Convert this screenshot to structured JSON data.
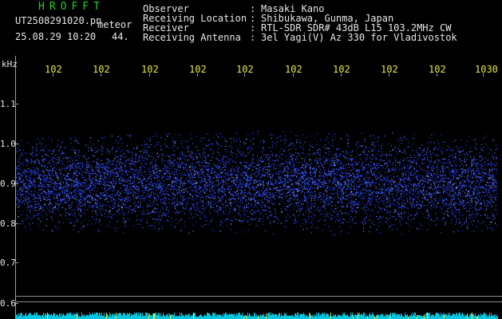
{
  "header": {
    "brand": "HROFFT",
    "file_name": "UT2508291020.pn",
    "tag": "meteor",
    "datetime": "25.08.29 10:20",
    "count": "44."
  },
  "meta": [
    {
      "label": "Observer",
      "sep": ":",
      "value": "Masaki Kano"
    },
    {
      "label": "Receiving Location",
      "sep": ":",
      "value": "Shibukawa, Gunma, Japan"
    },
    {
      "label": "Receiver",
      "sep": ":",
      "value": "RTL-SDR SDR# 43dB L15 103.2MHz CW"
    },
    {
      "label": "Receiving Antenna",
      "sep": ":",
      "value": "3el Yagi(V) Az 330 for Vladivostok"
    }
  ],
  "axis": {
    "unit": "kHz",
    "x_ticks": [
      "102",
      "102",
      "102",
      "102",
      "102",
      "102",
      "102",
      "102",
      "102",
      "1030"
    ],
    "y_ticks": [
      "1.1",
      "1.0",
      "0.9",
      "0.8",
      "0.7",
      "0.6"
    ]
  },
  "colors": {
    "background": "#000000",
    "text": "#e6e6e6",
    "brand": "#22cc22",
    "tick_x": "#e6e645",
    "signal_blue": "#2a3cff",
    "baseline": "#00c8e0"
  }
}
